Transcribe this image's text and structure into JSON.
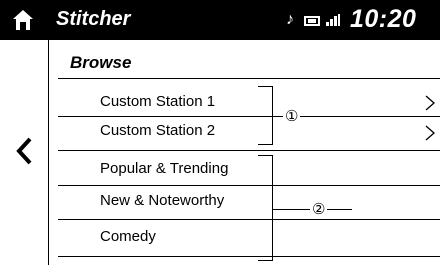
{
  "header": {
    "app_title": "Stitcher",
    "time": "10:20",
    "icons": [
      "home-icon",
      "music-note-icon",
      "battery-icon",
      "signal-icon"
    ]
  },
  "back": {
    "icon": "chevron-left-icon"
  },
  "list": {
    "title": "Browse",
    "items": [
      {
        "label": "Custom Station 1",
        "chevron": true
      },
      {
        "label": "Custom Station 2",
        "chevron": true
      },
      {
        "label": "Popular & Trending",
        "chevron": false
      },
      {
        "label": "New & Noteworthy",
        "chevron": false
      },
      {
        "label": "Comedy",
        "chevron": false
      }
    ]
  },
  "callouts": [
    {
      "label": "①"
    },
    {
      "label": "②"
    }
  ]
}
